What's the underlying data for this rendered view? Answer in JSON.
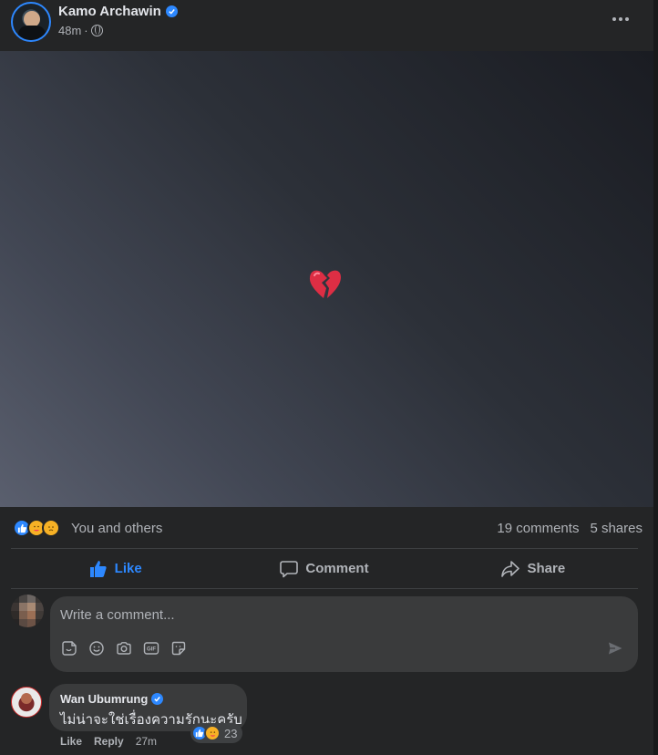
{
  "post": {
    "author": "Kamo Archawin",
    "time": "48m",
    "privacy_icon": "globe-icon",
    "more_icon": "more-options-icon",
    "content_emoji": "broken-heart"
  },
  "reactions": {
    "icons": [
      "like",
      "care",
      "sad"
    ],
    "summary_text": "You and others",
    "comments": "19 comments",
    "shares": "5 shares"
  },
  "actions": {
    "like": "Like",
    "comment": "Comment",
    "share": "Share"
  },
  "composer": {
    "placeholder": "Write a comment...",
    "tools": [
      "sticker-icon",
      "emoji-icon",
      "camera-icon",
      "gif-icon",
      "avatar-sticker-icon"
    ],
    "send_icon": "send-icon"
  },
  "comment": {
    "author": "Wan Ubumrung",
    "text": "ไม่น่าจะใช่เรื่องความรักนะครับ",
    "reaction_icons": [
      "like",
      "care"
    ],
    "reaction_count": "23",
    "like": "Like",
    "reply": "Reply",
    "time": "27m"
  },
  "colors": {
    "accent": "#2d88ff",
    "card": "#242526",
    "bubble": "#3a3b3c",
    "text_secondary": "#b0b3b8"
  }
}
